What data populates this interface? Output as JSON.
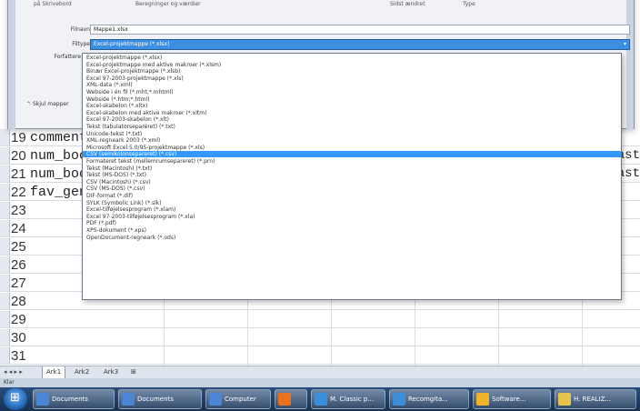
{
  "dialog": {
    "top_left": "på Skrivebord",
    "top_mid": "Beregninger og værdier",
    "top_right1": "Sidst ændret",
    "top_right2": "Type",
    "filename_label": "Filnavn:",
    "filename_value": "Mappe1.xlsx",
    "filetype_label": "Filtype:",
    "filetype_value": "Excel-projektmappe (*.xlsx)",
    "authors_label": "Forfattere:",
    "folder_toggle": "Skjul mapper"
  },
  "filetypes": [
    "Excel-projektmappe (*.xlsx)",
    "Excel-projektmappe med aktive makroer (*.xlsm)",
    "Binær Excel-projektmappe (*.xlsb)",
    "Excel 97-2003-projektmappe (*.xls)",
    "XML-data (*.xml)",
    "Webside i én fil (*.mht;*.mhtml)",
    "Webside (*.htm;*.html)",
    "Excel-skabelon (*.xltx)",
    "Excel-skabelon med aktive makroer (*.xltm)",
    "Excel 97-2003-skabelon (*.xlt)",
    "Tekst (tabulatorseparéret) (*.txt)",
    "Unicode-tekst (*.txt)",
    "XML-regneark 2003 (*.xml)",
    "Microsoft Excel 5.0/95-projektmappe (*.xls)",
    "CSV (semikolonsepareret) (*.csv)",
    "Formateret tekst (mellemrumsepareret) (*.prn)",
    "Tekst (Macintosh) (*.txt)",
    "Tekst (MS-DOS) (*.txt)",
    "CSV (Macintosh) (*.csv)",
    "CSV (MS-DOS) (*.csv)",
    "DIF-format (*.dif)",
    "SYLK (Symbolic Link) (*.slk)",
    "Excel-tilføjelsesprogram (*.xlam)",
    "Excel 97-2003-tilføjelsesprogram (*.xla)",
    "PDF (*.pdf)",
    "XPS-dokument (*.xps)",
    "OpenDocument-regneark (*.ods)"
  ],
  "selected_index": 14,
  "sheet": {
    "rows": [
      {
        "n": "19",
        "text": "comment:",
        "edge": ""
      },
      {
        "n": "20",
        "text": "num_boo",
        "edge": "ast"
      },
      {
        "n": "21",
        "text": "num_boo",
        "edge": "ast"
      },
      {
        "n": "22",
        "text": "fav_genre",
        "edge": ""
      },
      {
        "n": "23",
        "text": "",
        "edge": ""
      },
      {
        "n": "24",
        "text": "",
        "edge": ""
      },
      {
        "n": "25",
        "text": "",
        "edge": ""
      },
      {
        "n": "26",
        "text": "",
        "edge": ""
      },
      {
        "n": "27",
        "text": "",
        "edge": ""
      },
      {
        "n": "28",
        "text": "",
        "edge": ""
      },
      {
        "n": "29",
        "text": "",
        "edge": ""
      },
      {
        "n": "30",
        "text": "",
        "edge": ""
      },
      {
        "n": "31",
        "text": "",
        "edge": ""
      }
    ]
  },
  "tabs": {
    "nav": "◂ ◂ ▸ ▸",
    "items": [
      "Ark1",
      "Ark2",
      "Ark3"
    ]
  },
  "status": "Klar",
  "taskbar": {
    "items": [
      {
        "label": "Documents",
        "color": "#4a86d4"
      },
      {
        "label": "Documents",
        "color": "#4a86d4"
      },
      {
        "label": "Computer",
        "color": "#4a86d4"
      },
      {
        "label": "",
        "color": "#e8731c"
      },
      {
        "label": "M. Classic p...",
        "color": "#3a8fd8"
      },
      {
        "label": "Recomgita...",
        "color": "#3a8fd8"
      },
      {
        "label": "Software...",
        "color": "#f0b429"
      },
      {
        "label": "H. REALIZ...",
        "color": "#e6c34a"
      }
    ]
  }
}
